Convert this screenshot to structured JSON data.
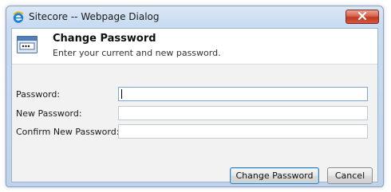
{
  "window": {
    "title": "Sitecore -- Webpage Dialog"
  },
  "header": {
    "title": "Change Password",
    "subtitle": "Enter your current and new password."
  },
  "form": {
    "fields": [
      {
        "label": "Password:",
        "value": ""
      },
      {
        "label": "New Password:",
        "value": ""
      },
      {
        "label": "Confirm New Password:",
        "value": ""
      }
    ]
  },
  "buttons": {
    "change_password": "Change Password",
    "cancel": "Cancel"
  },
  "icons": {
    "app": "ie-icon",
    "close": "close-icon",
    "header": "password-field-icon"
  },
  "colors": {
    "close_button": "#c0391f",
    "frame": "#c9dcf1",
    "body_background": "#f2f2f2"
  }
}
